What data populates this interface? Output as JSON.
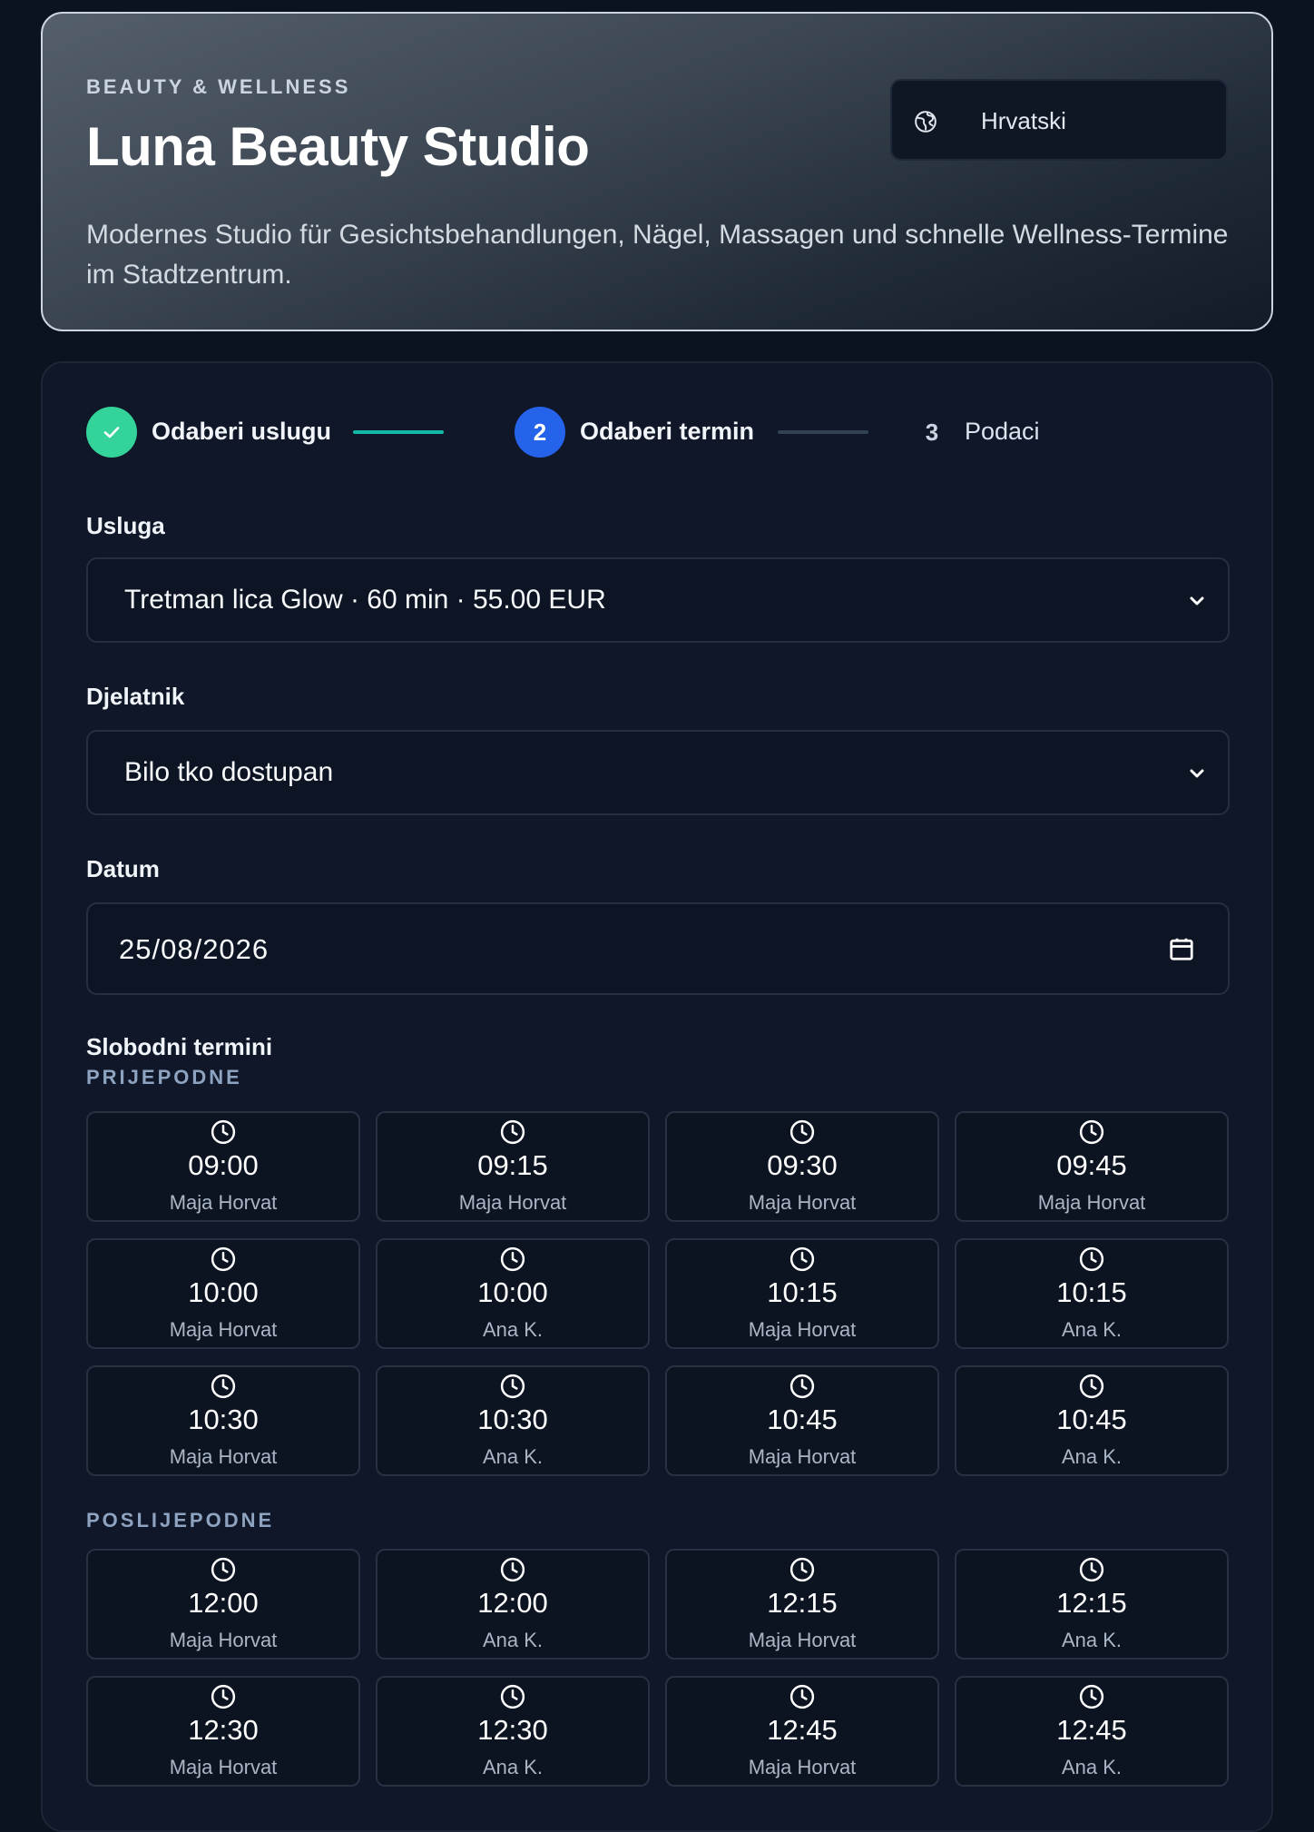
{
  "header": {
    "eyebrow": "BEAUTY & WELLNESS",
    "title": "Luna Beauty Studio",
    "description": "Modernes Studio für Gesichtsbehandlungen, Nägel, Massagen und schnelle Wellness-Termine im Stadtzentrum.",
    "language_label": "Hrvatski"
  },
  "stepper": {
    "steps": [
      {
        "number": "",
        "label": "Odaberi uslugu",
        "state": "done"
      },
      {
        "number": "2",
        "label": "Odaberi termin",
        "state": "active"
      },
      {
        "number": "3",
        "label": "Podaci",
        "state": "upcoming"
      }
    ]
  },
  "form": {
    "service_label": "Usluga",
    "service_value": "Tretman lica Glow · 60 min · 55.00 EUR",
    "staff_label": "Djelatnik",
    "staff_value": "Bilo tko dostupan",
    "date_label": "Datum",
    "date_value": "25/08/2026"
  },
  "slots": {
    "title": "Slobodni termini",
    "morning_label": "PRIJEPODNE",
    "afternoon_label": "POSLIJEPODNE",
    "morning": [
      {
        "time": "09:00",
        "staff": "Maja Horvat"
      },
      {
        "time": "09:15",
        "staff": "Maja Horvat"
      },
      {
        "time": "09:30",
        "staff": "Maja Horvat"
      },
      {
        "time": "09:45",
        "staff": "Maja Horvat"
      },
      {
        "time": "10:00",
        "staff": "Maja Horvat"
      },
      {
        "time": "10:00",
        "staff": "Ana K."
      },
      {
        "time": "10:15",
        "staff": "Maja Horvat"
      },
      {
        "time": "10:15",
        "staff": "Ana K."
      },
      {
        "time": "10:30",
        "staff": "Maja Horvat"
      },
      {
        "time": "10:30",
        "staff": "Ana K."
      },
      {
        "time": "10:45",
        "staff": "Maja Horvat"
      },
      {
        "time": "10:45",
        "staff": "Ana K."
      }
    ],
    "afternoon": [
      {
        "time": "12:00",
        "staff": "Maja Horvat"
      },
      {
        "time": "12:00",
        "staff": "Ana K."
      },
      {
        "time": "12:15",
        "staff": "Maja Horvat"
      },
      {
        "time": "12:15",
        "staff": "Ana K."
      },
      {
        "time": "12:30",
        "staff": "Maja Horvat"
      },
      {
        "time": "12:30",
        "staff": "Ana K."
      },
      {
        "time": "12:45",
        "staff": "Maja Horvat"
      },
      {
        "time": "12:45",
        "staff": "Ana K."
      }
    ]
  },
  "icons": {
    "language": "globe-icon",
    "select_arrow": "chevron-down-icon",
    "date_picker": "calendar-icon",
    "slot": "clock-icon",
    "step_done": "check-icon"
  },
  "colors": {
    "step_done": "#34d399",
    "step_active": "#2563eb",
    "line_done": "#14b8a6",
    "line_pending": "#334155"
  }
}
